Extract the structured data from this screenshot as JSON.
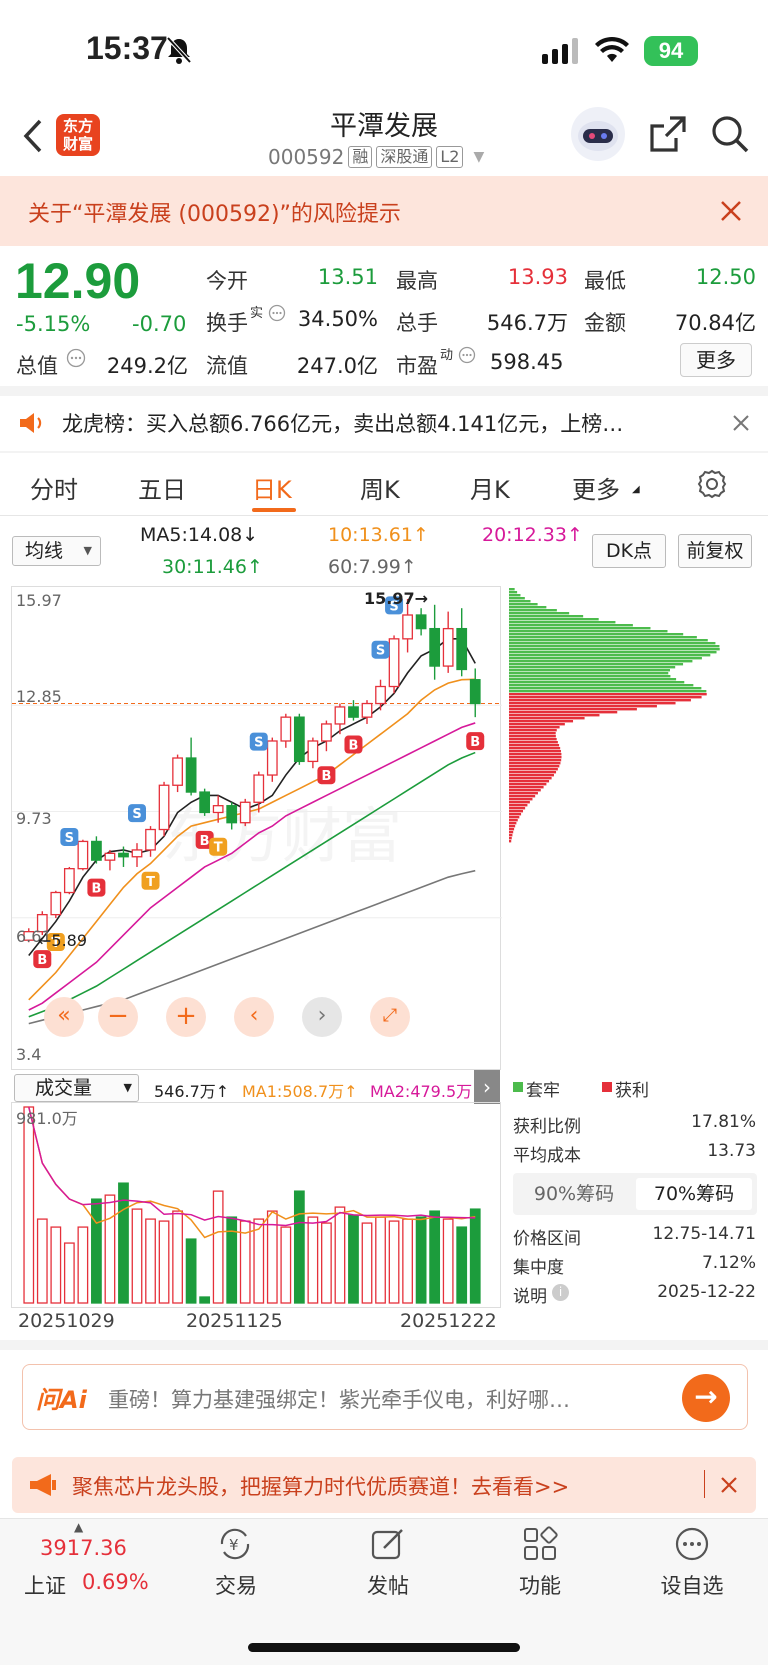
{
  "status_bar": {
    "time": "15:37",
    "battery": "94"
  },
  "header": {
    "logo_line1": "东方",
    "logo_line2": "财富",
    "stock_name": "平潭发展",
    "stock_code": "000592",
    "tags": [
      "融",
      "深股通",
      "L2"
    ]
  },
  "risk_banner": {
    "text": "关于“平潭发展 (000592)”的风险提示"
  },
  "quote": {
    "price": "12.90",
    "change_pct": "-5.15%",
    "change": "-0.70",
    "mkt_cap_label": "总值",
    "mkt_cap": "249.2亿",
    "open_label": "今开",
    "open": "13.51",
    "high_label": "最高",
    "high": "13.93",
    "low_label": "最低",
    "low": "12.50",
    "turnover_label": "换手",
    "turnover_sup": "实",
    "turnover": "34.50%",
    "volume_label": "总手",
    "volume": "546.7万",
    "amount_label": "金额",
    "amount": "70.84亿",
    "float_label": "流值",
    "float": "247.0亿",
    "pe_label": "市盈",
    "pe_sup": "动",
    "pe": "598.45",
    "more_label": "更多"
  },
  "dragon_tiger": {
    "text": "龙虎榜：买入总额6.766亿元，卖出总额4.141亿元，上榜…"
  },
  "tabs": [
    {
      "label": "分时"
    },
    {
      "label": "五日"
    },
    {
      "label": "日K"
    },
    {
      "label": "周K"
    },
    {
      "label": "月K"
    },
    {
      "label": "更多"
    }
  ],
  "ma_row": {
    "select": "均线",
    "ma5": "MA5:14.08↓",
    "ma10": "10:13.61↑",
    "ma20": "20:12.33↑",
    "ma30": "30:11.46↑",
    "ma60": "60:7.99↑",
    "dk_btn": "DK点",
    "fq_btn": "前复权"
  },
  "price_axis": {
    "top": "15.97",
    "mid1": "12.85",
    "mid2": "9.73",
    "mid3": "6.61",
    "bottom": "3.4"
  },
  "annotations": {
    "max": "15.97→",
    "min": "←5.89"
  },
  "volume_row": {
    "select": "成交量",
    "vol": "546.7万↑",
    "ma1": "MA1:508.7万↑",
    "ma2": "MA2:479.5万",
    "axis_top": "981.0万"
  },
  "dates": [
    "20251029",
    "20251125",
    "20251222"
  ],
  "chip": {
    "legend_trapped": "套牢",
    "legend_profit": "获利",
    "profit_ratio_label": "获利比例",
    "profit_ratio": "17.81%",
    "avg_cost_label": "平均成本",
    "avg_cost": "13.73",
    "tab90": "90%筹码",
    "tab70": "70%筹码",
    "range_label": "价格区间",
    "range": "12.75-14.71",
    "concentration_label": "集中度",
    "concentration": "7.12%",
    "note_label": "说明",
    "note_date": "2025-12-22"
  },
  "ai_bar": {
    "brand": "问Ai",
    "text": "重磅！算力基建强绑定！紫光牵手仪电，利好哪…"
  },
  "promo": {
    "text": "聚焦芯片龙头股，把握算力时代优质赛道！去看看>>"
  },
  "bottom_nav": {
    "index_value": "3917.36",
    "index_name": "上证",
    "index_pct": "0.69%",
    "items": [
      {
        "label": "交易"
      },
      {
        "label": "发帖"
      },
      {
        "label": "功能"
      },
      {
        "label": "设自选"
      }
    ]
  },
  "colors": {
    "up": "#e5303a",
    "down": "#1c9c3c",
    "accent": "#f26a1b"
  },
  "chart_data": {
    "type": "candlestick",
    "ylim": [
      3.4,
      15.97
    ],
    "x_ticks": [
      "20251029",
      "20251125",
      "20251222"
    ],
    "candles": [
      {
        "o": 5.95,
        "h": 6.3,
        "l": 5.89,
        "c": 6.2
      },
      {
        "o": 6.2,
        "h": 6.8,
        "l": 6.1,
        "c": 6.7
      },
      {
        "o": 6.7,
        "h": 7.4,
        "l": 6.6,
        "c": 7.35
      },
      {
        "o": 7.35,
        "h": 8.1,
        "l": 7.3,
        "c": 8.05
      },
      {
        "o": 8.05,
        "h": 8.9,
        "l": 8.0,
        "c": 8.85
      },
      {
        "o": 8.85,
        "h": 9.0,
        "l": 8.2,
        "c": 8.3
      },
      {
        "o": 8.3,
        "h": 8.6,
        "l": 8.0,
        "c": 8.5
      },
      {
        "o": 8.5,
        "h": 8.7,
        "l": 8.1,
        "c": 8.4
      },
      {
        "o": 8.4,
        "h": 8.8,
        "l": 8.1,
        "c": 8.6
      },
      {
        "o": 8.6,
        "h": 9.3,
        "l": 8.4,
        "c": 9.2
      },
      {
        "o": 9.2,
        "h": 10.6,
        "l": 9.0,
        "c": 10.5
      },
      {
        "o": 10.5,
        "h": 11.4,
        "l": 10.3,
        "c": 11.3
      },
      {
        "o": 11.3,
        "h": 11.9,
        "l": 10.2,
        "c": 10.3
      },
      {
        "o": 10.3,
        "h": 10.4,
        "l": 9.6,
        "c": 9.7
      },
      {
        "o": 9.7,
        "h": 10.2,
        "l": 9.4,
        "c": 9.9
      },
      {
        "o": 9.9,
        "h": 10.0,
        "l": 9.2,
        "c": 9.4
      },
      {
        "o": 9.4,
        "h": 10.1,
        "l": 9.3,
        "c": 10.0
      },
      {
        "o": 10.0,
        "h": 10.9,
        "l": 9.7,
        "c": 10.8
      },
      {
        "o": 10.8,
        "h": 11.9,
        "l": 10.6,
        "c": 11.8
      },
      {
        "o": 11.8,
        "h": 12.6,
        "l": 11.6,
        "c": 12.5
      },
      {
        "o": 12.5,
        "h": 12.6,
        "l": 11.1,
        "c": 11.2
      },
      {
        "o": 11.2,
        "h": 11.9,
        "l": 11.0,
        "c": 11.8
      },
      {
        "o": 11.8,
        "h": 12.4,
        "l": 11.5,
        "c": 12.3
      },
      {
        "o": 12.3,
        "h": 12.9,
        "l": 12.0,
        "c": 12.8
      },
      {
        "o": 12.8,
        "h": 13.0,
        "l": 12.4,
        "c": 12.5
      },
      {
        "o": 12.5,
        "h": 13.0,
        "l": 12.3,
        "c": 12.9
      },
      {
        "o": 12.9,
        "h": 13.6,
        "l": 12.7,
        "c": 13.4
      },
      {
        "o": 13.4,
        "h": 14.9,
        "l": 13.2,
        "c": 14.8
      },
      {
        "o": 14.8,
        "h": 15.97,
        "l": 14.4,
        "c": 15.5
      },
      {
        "o": 15.5,
        "h": 15.7,
        "l": 14.9,
        "c": 15.1
      },
      {
        "o": 15.1,
        "h": 15.8,
        "l": 13.6,
        "c": 14.0
      },
      {
        "o": 14.0,
        "h": 15.6,
        "l": 13.8,
        "c": 15.1
      },
      {
        "o": 15.1,
        "h": 15.7,
        "l": 13.7,
        "c": 13.9
      },
      {
        "o": 13.6,
        "h": 13.93,
        "l": 12.5,
        "c": 12.9
      }
    ],
    "volumes": [
      981,
      420,
      380,
      300,
      380,
      520,
      540,
      600,
      470,
      420,
      410,
      460,
      320,
      30,
      560,
      430,
      410,
      420,
      460,
      380,
      560,
      430,
      400,
      480,
      440,
      400,
      430,
      410,
      420,
      430,
      460,
      420,
      380,
      470
    ],
    "ma": {
      "MA5": [
        5.5,
        6.0,
        6.5,
        7.1,
        7.8,
        8.3,
        8.55,
        8.6,
        8.5,
        8.6,
        9.0,
        9.7,
        10.0,
        10.2,
        10.2,
        10.0,
        9.8,
        9.95,
        10.2,
        10.8,
        11.3,
        11.6,
        11.8,
        12.1,
        12.3,
        12.5,
        12.8,
        13.2,
        13.8,
        14.3,
        14.5,
        14.8,
        14.8,
        14.08
      ],
      "MA10": [
        4.2,
        4.6,
        5.0,
        5.5,
        6.0,
        6.5,
        7.0,
        7.5,
        7.9,
        8.2,
        8.6,
        9.0,
        9.3,
        9.4,
        9.5,
        9.6,
        9.7,
        9.8,
        10.0,
        10.2,
        10.4,
        10.6,
        10.8,
        11.1,
        11.4,
        11.7,
        12.0,
        12.3,
        12.6,
        13.0,
        13.3,
        13.5,
        13.6,
        13.61
      ],
      "MA20": [
        3.9,
        4.1,
        4.4,
        4.7,
        5.0,
        5.3,
        5.7,
        6.1,
        6.5,
        6.9,
        7.2,
        7.5,
        7.8,
        8.1,
        8.3,
        8.5,
        8.8,
        9.1,
        9.3,
        9.6,
        9.8,
        10.0,
        10.2,
        10.4,
        10.6,
        10.8,
        11.0,
        11.2,
        11.4,
        11.6,
        11.8,
        12.0,
        12.2,
        12.33
      ],
      "MA30": [
        3.7,
        3.85,
        4.0,
        4.2,
        4.4,
        4.6,
        4.85,
        5.1,
        5.35,
        5.6,
        5.85,
        6.1,
        6.35,
        6.6,
        6.85,
        7.1,
        7.35,
        7.6,
        7.85,
        8.1,
        8.35,
        8.6,
        8.85,
        9.1,
        9.35,
        9.6,
        9.85,
        10.1,
        10.35,
        10.6,
        10.85,
        11.1,
        11.3,
        11.46
      ],
      "MA60": [
        3.5,
        3.6,
        3.7,
        3.8,
        3.9,
        4.0,
        4.1,
        4.2,
        4.35,
        4.5,
        4.65,
        4.8,
        4.95,
        5.1,
        5.25,
        5.4,
        5.55,
        5.7,
        5.85,
        6.0,
        6.15,
        6.3,
        6.45,
        6.6,
        6.75,
        6.9,
        7.05,
        7.2,
        7.35,
        7.5,
        7.65,
        7.8,
        7.9,
        7.99
      ]
    }
  }
}
